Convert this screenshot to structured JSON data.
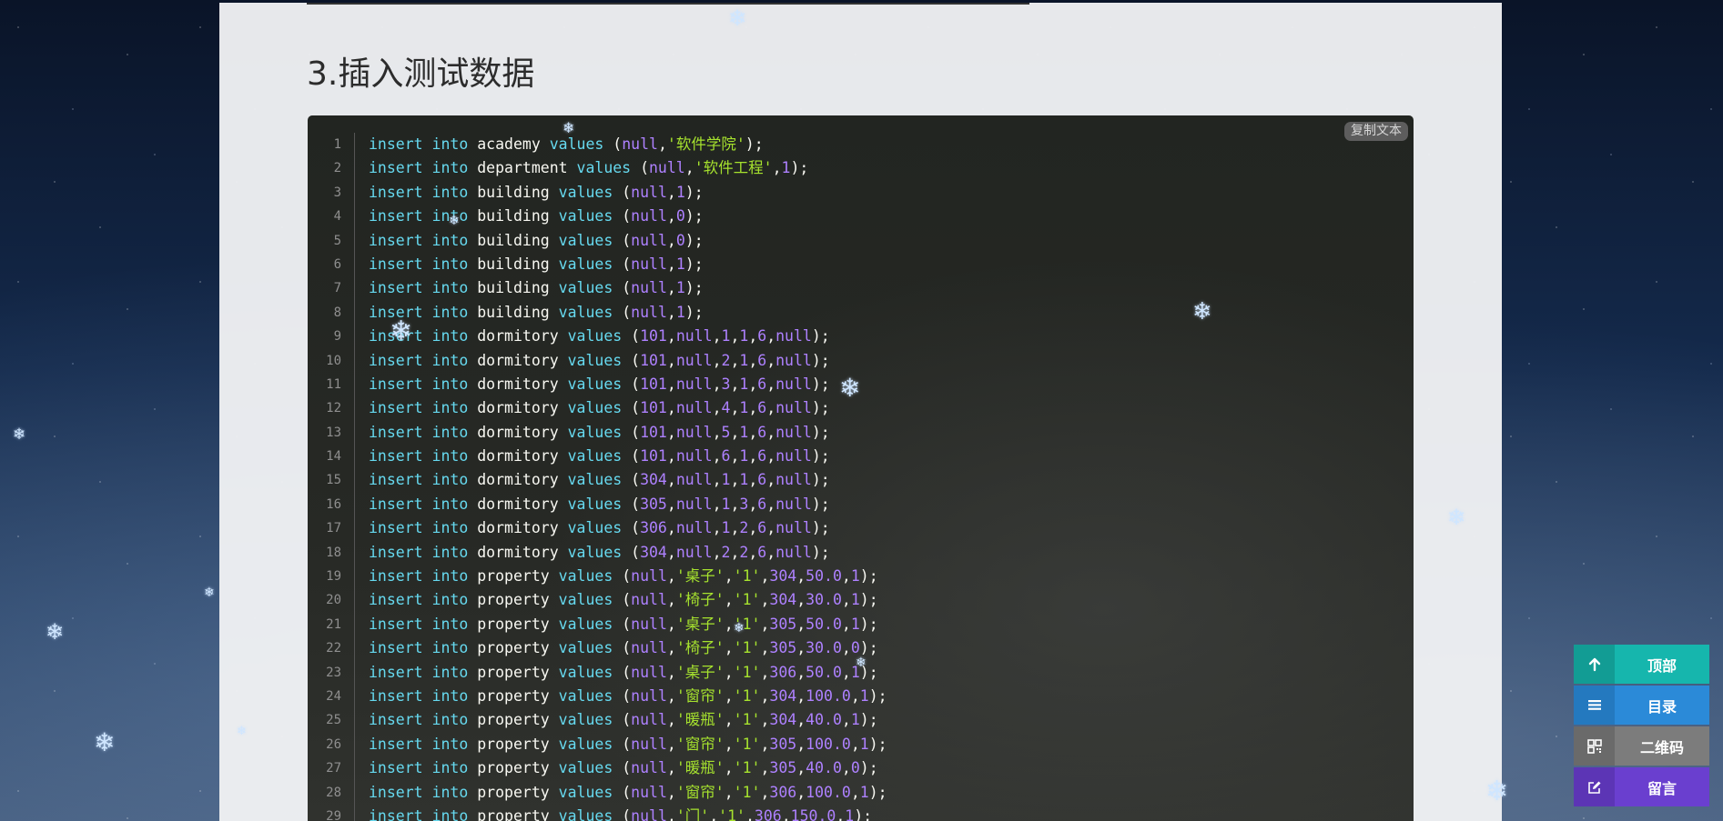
{
  "page": {
    "section_heading": "3.插入测试数据",
    "copy_button_label": "复制文本"
  },
  "code_block": {
    "language": "sql",
    "colors": {
      "background": "#262824",
      "keyword": "#66d9ef",
      "number": "#ae81ff",
      "string": "#a6e22e",
      "text": "#f8f8f2",
      "line_number": "#8f8f8f"
    },
    "lines": [
      "insert into academy values (null,'软件学院');",
      "insert into department values (null,'软件工程',1);",
      "insert into building values (null,1);",
      "insert into building values (null,0);",
      "insert into building values (null,0);",
      "insert into building values (null,1);",
      "insert into building values (null,1);",
      "insert into building values (null,1);",
      "insert into dormitory values (101,null,1,1,6,null);",
      "insert into dormitory values (101,null,2,1,6,null);",
      "insert into dormitory values (101,null,3,1,6,null);",
      "insert into dormitory values (101,null,4,1,6,null);",
      "insert into dormitory values (101,null,5,1,6,null);",
      "insert into dormitory values (101,null,6,1,6,null);",
      "insert into dormitory values (304,null,1,1,6,null);",
      "insert into dormitory values (305,null,1,3,6,null);",
      "insert into dormitory values (306,null,1,2,6,null);",
      "insert into dormitory values (304,null,2,2,6,null);",
      "insert into property values (null,'桌子','1',304,50.0,1);",
      "insert into property values (null,'椅子','1',304,30.0,1);",
      "insert into property values (null,'桌子','1',305,50.0,1);",
      "insert into property values (null,'椅子','1',305,30.0,0);",
      "insert into property values (null,'桌子','1',306,50.0,1);",
      "insert into property values (null,'窗帘','1',304,100.0,1);",
      "insert into property values (null,'暖瓶','1',304,40.0,1);",
      "insert into property values (null,'窗帘','1',305,100.0,1);",
      "insert into property values (null,'暖瓶','1',305,40.0,0);",
      "insert into property values (null,'窗帘','1',306,100.0,1);",
      "insert into property values (null,'门','1',306,150.0,1);"
    ],
    "line_numbers": [
      "1",
      "2",
      "3",
      "4",
      "5",
      "6",
      "7",
      "8",
      "9",
      "10",
      "11",
      "12",
      "13",
      "14",
      "15",
      "16",
      "17",
      "18",
      "19",
      "20",
      "21",
      "22",
      "23",
      "24",
      "25",
      "26",
      "27",
      "28",
      "29"
    ]
  },
  "floating_nav": {
    "items": [
      {
        "label": "顶部",
        "icon": "arrow-up-icon",
        "color": "#16b6ad"
      },
      {
        "label": "目录",
        "icon": "list-icon",
        "color": "#2b8ad8"
      },
      {
        "label": "二维码",
        "icon": "qrcode-icon",
        "color": "#7c7c7c"
      },
      {
        "label": "留言",
        "icon": "edit-icon",
        "color": "#6a3fcf"
      }
    ]
  },
  "decorations": {
    "snowflake_glyph": "❄"
  }
}
